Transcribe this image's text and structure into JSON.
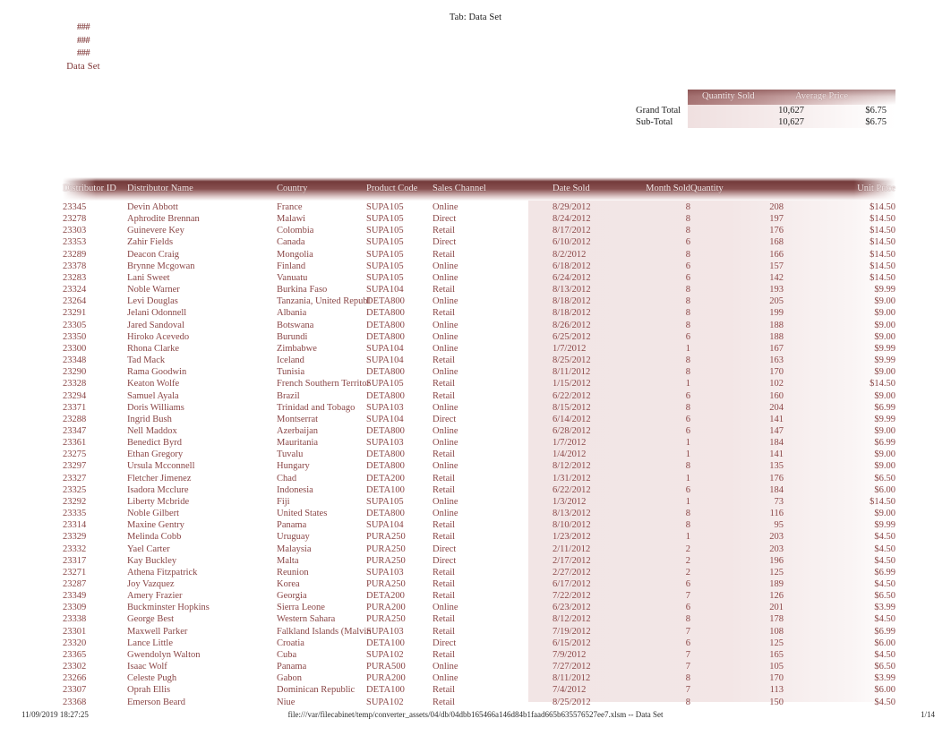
{
  "header": {
    "tab_label": "Tab: Data Set"
  },
  "nav": {
    "items": [
      {
        "label": "###"
      },
      {
        "label": "###"
      },
      {
        "label": "###"
      },
      {
        "label": "Data Set"
      }
    ]
  },
  "totals": {
    "columns": [
      "Quantity Sold",
      "Average Price"
    ],
    "rows": [
      {
        "label": "Grand Total",
        "quantity_sold": "10,627",
        "average_price": "$6.75"
      },
      {
        "label": "Sub-Total",
        "quantity_sold": "10,627",
        "average_price": "$6.75"
      }
    ]
  },
  "table": {
    "columns": [
      "Distributor ID",
      "Distributor Name",
      "Country",
      "Product Code",
      "Sales Channel",
      "Date Sold",
      "Month Sold",
      "Quantity",
      "Unit Price"
    ],
    "rows": [
      [
        "23345",
        "Devin Abbott",
        "France",
        "SUPA105",
        "Online",
        "8/29/2012",
        "8",
        "208",
        "$14.50"
      ],
      [
        "23278",
        "Aphrodite Brennan",
        "Malawi",
        "SUPA105",
        "Direct",
        "8/24/2012",
        "8",
        "197",
        "$14.50"
      ],
      [
        "23303",
        "Guinevere Key",
        "Colombia",
        "SUPA105",
        "Retail",
        "8/17/2012",
        "8",
        "176",
        "$14.50"
      ],
      [
        "23353",
        "Zahir Fields",
        "Canada",
        "SUPA105",
        "Direct",
        "6/10/2012",
        "6",
        "168",
        "$14.50"
      ],
      [
        "23289",
        "Deacon Craig",
        "Mongolia",
        "SUPA105",
        "Retail",
        "8/2/2012",
        "8",
        "166",
        "$14.50"
      ],
      [
        "23378",
        "Brynne Mcgowan",
        "Finland",
        "SUPA105",
        "Online",
        "6/18/2012",
        "6",
        "157",
        "$14.50"
      ],
      [
        "23283",
        "Lani Sweet",
        "Vanuatu",
        "SUPA105",
        "Online",
        "6/24/2012",
        "6",
        "142",
        "$14.50"
      ],
      [
        "23324",
        "Noble Warner",
        "Burkina Faso",
        "SUPA104",
        "Retail",
        "8/13/2012",
        "8",
        "193",
        "$9.99"
      ],
      [
        "23264",
        "Levi Douglas",
        "Tanzania, United Republ",
        "DETA800",
        "Online",
        "8/18/2012",
        "8",
        "205",
        "$9.00"
      ],
      [
        "23291",
        "Jelani Odonnell",
        "Albania",
        "DETA800",
        "Retail",
        "8/18/2012",
        "8",
        "199",
        "$9.00"
      ],
      [
        "23305",
        "Jared Sandoval",
        "Botswana",
        "DETA800",
        "Online",
        "8/26/2012",
        "8",
        "188",
        "$9.00"
      ],
      [
        "23350",
        "Hiroko Acevedo",
        "Burundi",
        "DETA800",
        "Online",
        "6/25/2012",
        "6",
        "188",
        "$9.00"
      ],
      [
        "23300",
        "Rhona Clarke",
        "Zimbabwe",
        "SUPA104",
        "Online",
        "1/7/2012",
        "1",
        "167",
        "$9.99"
      ],
      [
        "23348",
        "Tad Mack",
        "Iceland",
        "SUPA104",
        "Retail",
        "8/25/2012",
        "8",
        "163",
        "$9.99"
      ],
      [
        "23290",
        "Rama Goodwin",
        "Tunisia",
        "DETA800",
        "Online",
        "8/11/2012",
        "8",
        "170",
        "$9.00"
      ],
      [
        "23328",
        "Keaton Wolfe",
        "French Southern Territor",
        "SUPA105",
        "Retail",
        "1/15/2012",
        "1",
        "102",
        "$14.50"
      ],
      [
        "23294",
        "Samuel Ayala",
        "Brazil",
        "DETA800",
        "Retail",
        "6/22/2012",
        "6",
        "160",
        "$9.00"
      ],
      [
        "23371",
        "Doris Williams",
        "Trinidad and Tobago",
        "SUPA103",
        "Online",
        "8/15/2012",
        "8",
        "204",
        "$6.99"
      ],
      [
        "23288",
        "Ingrid Bush",
        "Montserrat",
        "SUPA104",
        "Direct",
        "6/14/2012",
        "6",
        "141",
        "$9.99"
      ],
      [
        "23347",
        "Nell Maddox",
        "Azerbaijan",
        "DETA800",
        "Online",
        "6/28/2012",
        "6",
        "147",
        "$9.00"
      ],
      [
        "23361",
        "Benedict Byrd",
        "Mauritania",
        "SUPA103",
        "Online",
        "1/7/2012",
        "1",
        "184",
        "$6.99"
      ],
      [
        "23275",
        "Ethan Gregory",
        "Tuvalu",
        "DETA800",
        "Retail",
        "1/4/2012",
        "1",
        "141",
        "$9.00"
      ],
      [
        "23297",
        "Ursula Mcconnell",
        "Hungary",
        "DETA800",
        "Online",
        "8/12/2012",
        "8",
        "135",
        "$9.00"
      ],
      [
        "23327",
        "Fletcher Jimenez",
        "Chad",
        "DETA200",
        "Retail",
        "1/31/2012",
        "1",
        "176",
        "$6.50"
      ],
      [
        "23325",
        "Isadora Mcclure",
        "Indonesia",
        "DETA100",
        "Retail",
        "6/22/2012",
        "6",
        "184",
        "$6.00"
      ],
      [
        "23292",
        "Liberty Mcbride",
        "Fiji",
        "SUPA105",
        "Online",
        "1/3/2012",
        "1",
        "73",
        "$14.50"
      ],
      [
        "23335",
        "Noble Gilbert",
        "United States",
        "DETA800",
        "Online",
        "8/13/2012",
        "8",
        "116",
        "$9.00"
      ],
      [
        "23314",
        "Maxine Gentry",
        "Panama",
        "SUPA104",
        "Retail",
        "8/10/2012",
        "8",
        "95",
        "$9.99"
      ],
      [
        "23329",
        "Melinda Cobb",
        "Uruguay",
        "PURA250",
        "Retail",
        "1/23/2012",
        "1",
        "203",
        "$4.50"
      ],
      [
        "23332",
        "Yael Carter",
        "Malaysia",
        "PURA250",
        "Direct",
        "2/11/2012",
        "2",
        "203",
        "$4.50"
      ],
      [
        "23317",
        "Kay Buckley",
        "Malta",
        "PURA250",
        "Direct",
        "2/17/2012",
        "2",
        "196",
        "$4.50"
      ],
      [
        "23271",
        "Athena Fitzpatrick",
        "Reunion",
        "SUPA103",
        "Retail",
        "2/27/2012",
        "2",
        "125",
        "$6.99"
      ],
      [
        "23287",
        "Joy Vazquez",
        "Korea",
        "PURA250",
        "Retail",
        "6/17/2012",
        "6",
        "189",
        "$4.50"
      ],
      [
        "23349",
        "Amery Frazier",
        "Georgia",
        "DETA200",
        "Retail",
        "7/22/2012",
        "7",
        "126",
        "$6.50"
      ],
      [
        "23309",
        "Buckminster Hopkins",
        "Sierra Leone",
        "PURA200",
        "Online",
        "6/23/2012",
        "6",
        "201",
        "$3.99"
      ],
      [
        "23338",
        "George Best",
        "Western Sahara",
        "PURA250",
        "Retail",
        "8/12/2012",
        "8",
        "178",
        "$4.50"
      ],
      [
        "23301",
        "Maxwell Parker",
        "Falkland Islands (Malvin",
        "SUPA103",
        "Retail",
        "7/19/2012",
        "7",
        "108",
        "$6.99"
      ],
      [
        "23320",
        "Lance Little",
        "Croatia",
        "DETA100",
        "Direct",
        "6/15/2012",
        "6",
        "125",
        "$6.00"
      ],
      [
        "23365",
        "Gwendolyn Walton",
        "Cuba",
        "SUPA102",
        "Retail",
        "7/9/2012",
        "7",
        "165",
        "$4.50"
      ],
      [
        "23302",
        "Isaac Wolf",
        "Panama",
        "PURA500",
        "Online",
        "7/27/2012",
        "7",
        "105",
        "$6.50"
      ],
      [
        "23266",
        "Celeste Pugh",
        "Gabon",
        "PURA200",
        "Online",
        "8/11/2012",
        "8",
        "170",
        "$3.99"
      ],
      [
        "23307",
        "Oprah Ellis",
        "Dominican Republic",
        "DETA100",
        "Retail",
        "7/4/2012",
        "7",
        "113",
        "$6.00"
      ],
      [
        "23368",
        "Emerson Beard",
        "Niue",
        "SUPA102",
        "Retail",
        "8/25/2012",
        "8",
        "150",
        "$4.50"
      ]
    ]
  },
  "footer": {
    "timestamp": "11/09/2019 18:27:25",
    "path": "file:///var/filecabinet/temp/converter_assets/04/db/04dbb165466a146d84b1faad665b635576527ee7.xlsm -- Data Set",
    "page": "1/14"
  },
  "colors": {
    "accent_dark": "#6b2a2a",
    "accent_text": "#8a4646",
    "header_text": "#f6ebeb",
    "row_wash": "#e2c6c6"
  }
}
